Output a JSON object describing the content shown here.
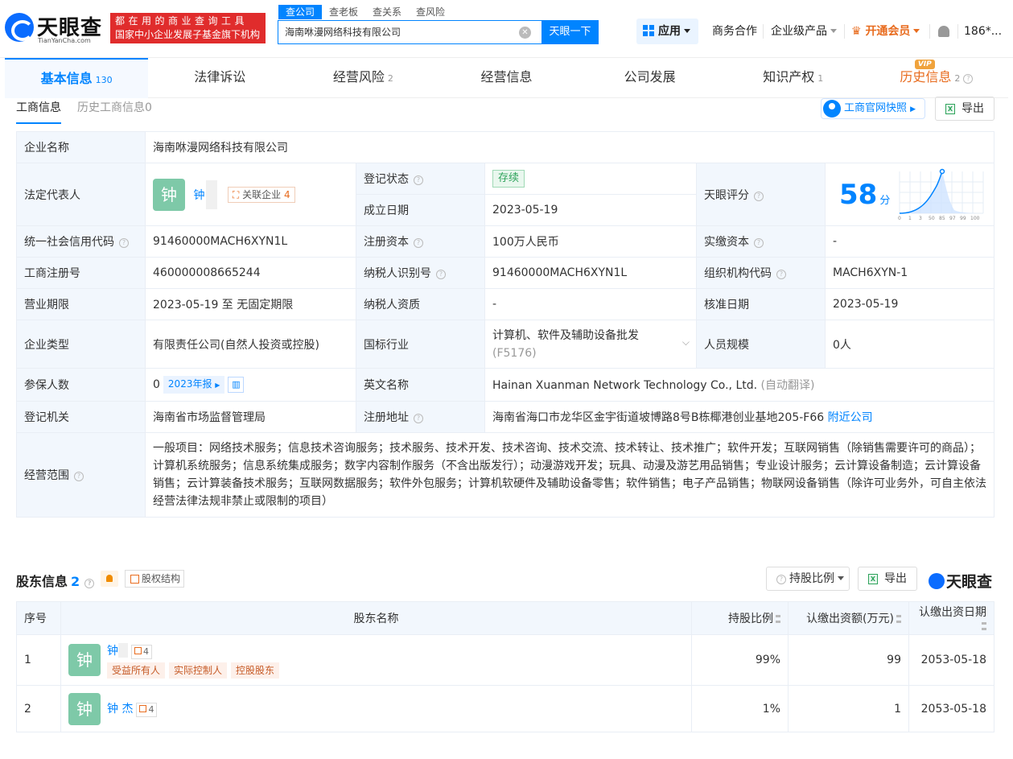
{
  "header": {
    "logo_name": "天眼查",
    "logo_sub": "TianYanCha.com",
    "slogan_line1": "都在用的商业查询工具",
    "slogan_line2": "国家中小企业发展子基金旗下机构",
    "search_tabs": [
      "查公司",
      "查老板",
      "查关系",
      "查风险"
    ],
    "search_value": "海南咻漫网络科技有限公司",
    "search_button": "天眼一下",
    "nav_app": "应用",
    "nav_business": "商务合作",
    "nav_enterprise": "企业级产品",
    "nav_vip": "开通会员",
    "nav_user": "186*..."
  },
  "tabs": [
    {
      "label": "基本信息",
      "count": "130"
    },
    {
      "label": "法律诉讼",
      "count": ""
    },
    {
      "label": "经营风险",
      "count": "2"
    },
    {
      "label": "经营信息",
      "count": ""
    },
    {
      "label": "公司发展",
      "count": ""
    },
    {
      "label": "知识产权",
      "count": "1"
    },
    {
      "label": "历史信息",
      "count": "2",
      "badge": "VIP"
    }
  ],
  "subtabs": {
    "current": "工商信息",
    "history": "历史工商信息0"
  },
  "buttons": {
    "snapshot": "工商官网快照",
    "export": "导出"
  },
  "info": {
    "company_name_k": "企业名称",
    "company_name_v": "海南咻漫网络科技有限公司",
    "legal_rep_k": "法定代表人",
    "legal_rep_avatar": "钟",
    "legal_rep_name": "钟",
    "related_label": "关联企业",
    "related_count": "4",
    "reg_status_k": "登记状态",
    "reg_status_v": "存续",
    "found_date_k": "成立日期",
    "found_date_v": "2023-05-19",
    "score_k": "天眼评分",
    "score_v": "58",
    "score_unit": "分",
    "score_ticks": [
      "0",
      "1",
      "3",
      "50",
      "85",
      "97",
      "99",
      "100"
    ],
    "credit_k": "统一社会信用代码",
    "credit_v": "91460000MACH6XYN1L",
    "capital_k": "注册资本",
    "capital_v": "100万人民币",
    "paid_k": "实缴资本",
    "paid_v": "-",
    "regno_k": "工商注册号",
    "regno_v": "460000008665244",
    "taxid_k": "纳税人识别号",
    "taxid_v": "91460000MACH6XYN1L",
    "orgcode_k": "组织机构代码",
    "orgcode_v": "MACH6XYN-1",
    "term_k": "营业期限",
    "term_v": "2023-05-19 至 无固定期限",
    "taxq_k": "纳税人资质",
    "taxq_v": "-",
    "approve_k": "核准日期",
    "approve_v": "2023-05-19",
    "type_k": "企业类型",
    "type_v": "有限责任公司(自然人投资或控股)",
    "industry_k": "国标行业",
    "industry_v": "计算机、软件及辅助设备批发",
    "industry_code": "(F5176)",
    "staff_k": "人员规模",
    "staff_v": "0人",
    "insured_k": "参保人数",
    "insured_v": "0",
    "insured_tag": "2023年报",
    "en_k": "英文名称",
    "en_v": "Hainan Xuanman Network Technology Co., Ltd.",
    "en_note": "(自动翻译)",
    "authority_k": "登记机关",
    "authority_v": "海南省市场监督管理局",
    "addr_k": "注册地址",
    "addr_v": "海南省海口市龙华区金宇街道坡博路8号B栋椰港创业基地205-F66",
    "addr_link": "附近公司",
    "scope_k": "经营范围",
    "scope_v": "一般项目：网络技术服务；信息技术咨询服务；技术服务、技术开发、技术咨询、技术交流、技术转让、技术推广；软件开发；互联网销售（除销售需要许可的商品）；计算机系统服务；信息系统集成服务；数字内容制作服务（不含出版发行）；动漫游戏开发；玩具、动漫及游艺用品销售；专业设计服务；云计算设备制造；云计算设备销售；云计算装备技术服务；互联网数据服务；软件外包服务；计算机软硬件及辅助设备零售；软件销售；电子产品销售；物联网设备销售（除许可业务外，可自主依法经营法律法规非禁止或限制的项目）"
  },
  "shareholders": {
    "title": "股东信息",
    "count": "2",
    "equity_btn": "股权结构",
    "ratio_btn": "持股比例",
    "export": "导出",
    "brand": "天眼查",
    "columns": [
      "序号",
      "股东名称",
      "持股比例",
      "认缴出资额(万元)",
      "认缴出资日期"
    ],
    "rows": [
      {
        "no": "1",
        "avatar": "钟",
        "name": "钟",
        "count": "4",
        "tags": [
          "受益所有人",
          "实际控制人",
          "控股股东"
        ],
        "ratio": "99%",
        "amount": "99",
        "date": "2053-05-18"
      },
      {
        "no": "2",
        "avatar": "钟",
        "name": "钟 杰",
        "count": "4",
        "tags": [],
        "ratio": "1%",
        "amount": "1",
        "date": "2053-05-18"
      }
    ]
  }
}
